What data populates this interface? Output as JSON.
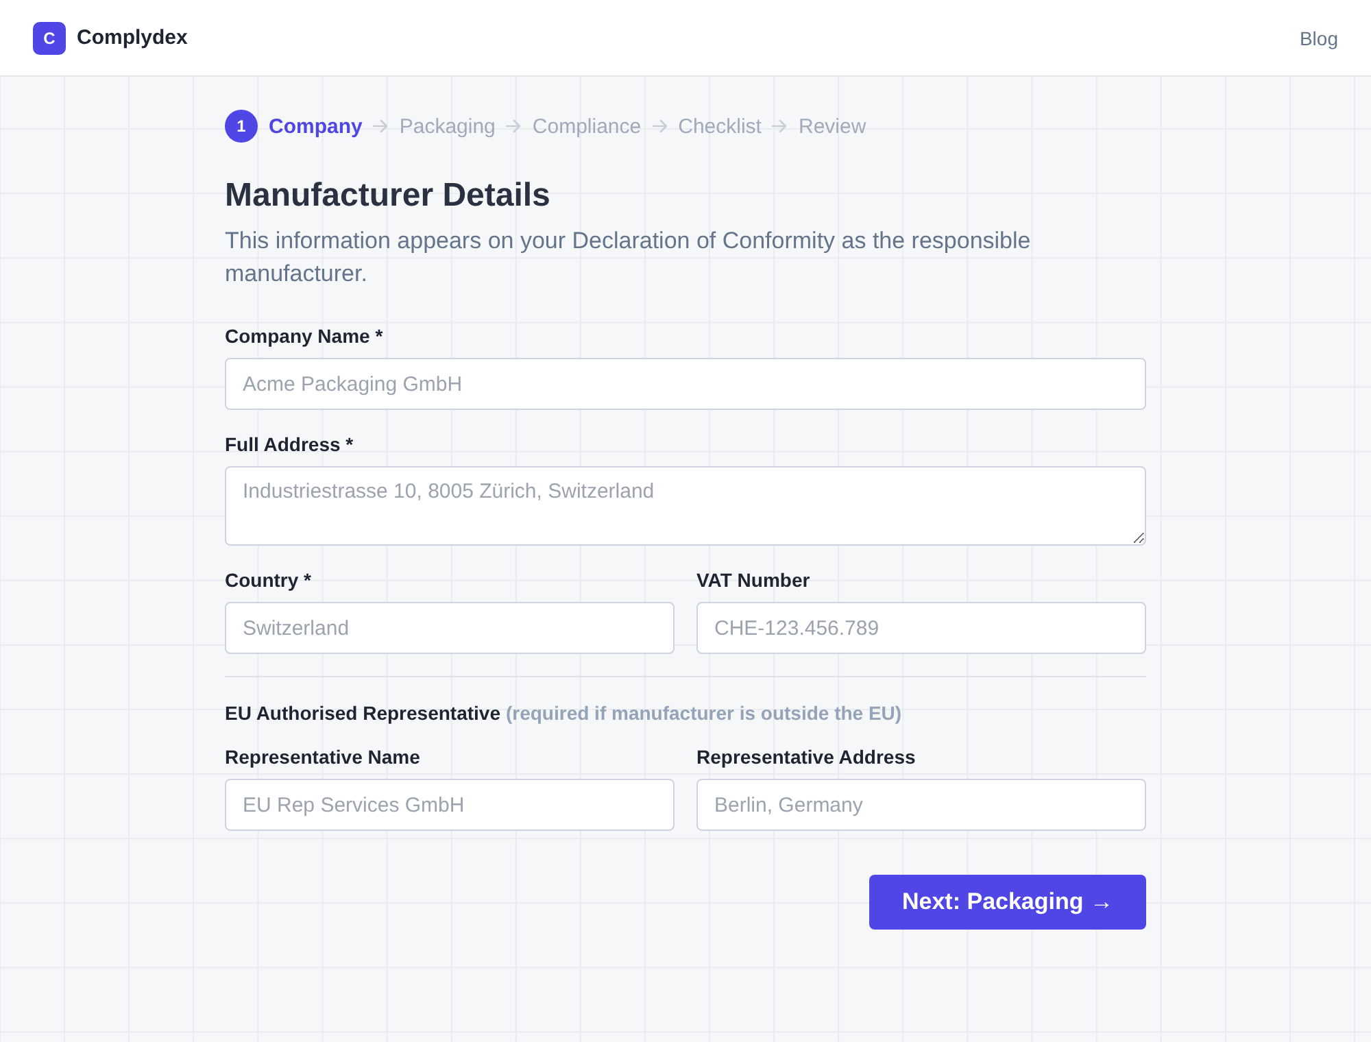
{
  "header": {
    "logo_letter": "C",
    "brand": "Complydex",
    "nav_link": "Blog"
  },
  "steps": [
    {
      "number": "1",
      "label": "Company",
      "selected": true
    },
    {
      "label": "Packaging",
      "selected": false
    },
    {
      "label": "Compliance",
      "selected": false
    },
    {
      "label": "Checklist",
      "selected": false
    },
    {
      "label": "Review",
      "selected": false
    }
  ],
  "form": {
    "title": "Manufacturer Details",
    "description": "This information appears on your Declaration of Conformity as the responsible manufacturer.",
    "rows": [
      {
        "fields": [
          {
            "kind": "text",
            "label": "Company Name *",
            "placeholder": "Acme Packaging GmbH"
          }
        ]
      },
      {
        "fields": [
          {
            "kind": "textarea",
            "label": "Full Address *",
            "placeholder": "Industriestrasse 10, 8005 Zürich, Switzerland"
          }
        ]
      },
      {
        "fields": [
          {
            "kind": "text",
            "label": "Country *",
            "placeholder": "Switzerland"
          },
          {
            "kind": "text",
            "label": "VAT Number",
            "placeholder": "CHE-123.456.789"
          }
        ]
      }
    ],
    "representative": {
      "title": "EU Authorised Representative",
      "note": "(required if manufacturer is outside the EU)",
      "rows": [
        {
          "fields": [
            {
              "kind": "text",
              "label": "Representative Name",
              "placeholder": "EU Rep Services GmbH"
            },
            {
              "kind": "text",
              "label": "Representative Address",
              "placeholder": "Berlin, Germany"
            }
          ]
        }
      ]
    },
    "next_button": "Next: Packaging →"
  }
}
